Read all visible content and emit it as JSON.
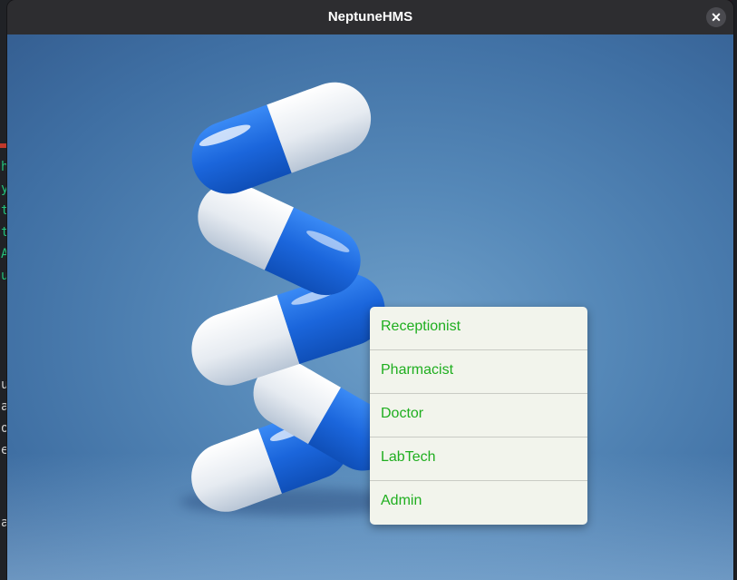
{
  "window": {
    "title": "NeptuneHMS",
    "close_symbol": "✕"
  },
  "menu": {
    "items": [
      {
        "label": "Receptionist"
      },
      {
        "label": "Pharmacist"
      },
      {
        "label": "Doctor"
      },
      {
        "label": "LabTech"
      },
      {
        "label": "Admin"
      }
    ],
    "text_color": "#1fae1f",
    "background_color": "#f2f4ec"
  },
  "background": {
    "image": "capsule-pills-icon",
    "pill_colors": [
      "#1f6fe0",
      "#f2f4f7"
    ]
  },
  "desktop_fragments": [
    "h",
    "y",
    "t",
    "t",
    "A",
    "u",
    "u",
    "a",
    "o",
    "e",
    "ai"
  ]
}
